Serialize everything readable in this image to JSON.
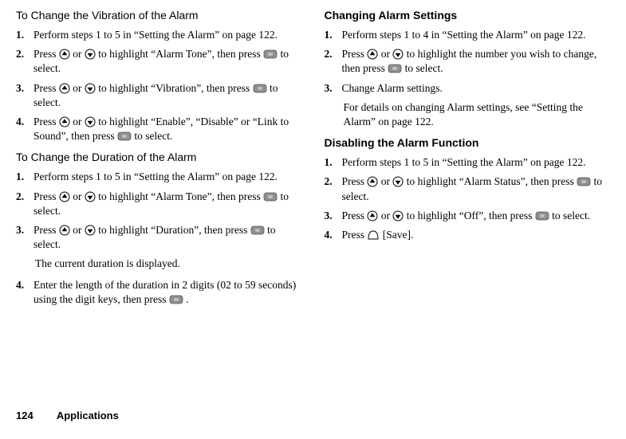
{
  "left": {
    "sectionA": {
      "title": "To Change the Vibration of the Alarm",
      "steps": [
        {
          "num": "1.",
          "text": "Perform steps 1 to 5 in “Setting the Alarm” on page 122."
        },
        {
          "num": "2.",
          "segments": [
            {
              "t": "text",
              "v": "Press "
            },
            {
              "t": "icon",
              "v": "up"
            },
            {
              "t": "text",
              "v": " or "
            },
            {
              "t": "icon",
              "v": "down"
            },
            {
              "t": "text",
              "v": " to highlight “Alarm Tone”, then press "
            },
            {
              "t": "icon",
              "v": "center"
            },
            {
              "t": "text",
              "v": " to select."
            }
          ]
        },
        {
          "num": "3.",
          "segments": [
            {
              "t": "text",
              "v": "Press "
            },
            {
              "t": "icon",
              "v": "up"
            },
            {
              "t": "text",
              "v": " or "
            },
            {
              "t": "icon",
              "v": "down"
            },
            {
              "t": "text",
              "v": " to highlight “Vibration”, then press "
            },
            {
              "t": "icon",
              "v": "center"
            },
            {
              "t": "text",
              "v": " to select."
            }
          ]
        },
        {
          "num": "4.",
          "segments": [
            {
              "t": "text",
              "v": "Press "
            },
            {
              "t": "icon",
              "v": "up"
            },
            {
              "t": "text",
              "v": " or "
            },
            {
              "t": "icon",
              "v": "down"
            },
            {
              "t": "text",
              "v": " to highlight “Enable”, “Disable” or “Link to Sound”, then press "
            },
            {
              "t": "icon",
              "v": "center"
            },
            {
              "t": "text",
              "v": " to select."
            }
          ]
        }
      ]
    },
    "sectionB": {
      "title": "To Change the Duration of the Alarm",
      "steps": [
        {
          "num": "1.",
          "text": "Perform steps 1 to 5 in “Setting the Alarm” on page 122."
        },
        {
          "num": "2.",
          "segments": [
            {
              "t": "text",
              "v": "Press "
            },
            {
              "t": "icon",
              "v": "up"
            },
            {
              "t": "text",
              "v": " or "
            },
            {
              "t": "icon",
              "v": "down"
            },
            {
              "t": "text",
              "v": " to highlight “Alarm Tone”, then press "
            },
            {
              "t": "icon",
              "v": "center"
            },
            {
              "t": "text",
              "v": " to select."
            }
          ]
        },
        {
          "num": "3.",
          "segments": [
            {
              "t": "text",
              "v": "Press "
            },
            {
              "t": "icon",
              "v": "up"
            },
            {
              "t": "text",
              "v": " or "
            },
            {
              "t": "icon",
              "v": "down"
            },
            {
              "t": "text",
              "v": " to highlight “Duration”, then press "
            },
            {
              "t": "icon",
              "v": "center"
            },
            {
              "t": "text",
              "v": " to select."
            }
          ],
          "note": "The current duration is displayed."
        },
        {
          "num": "4.",
          "segments": [
            {
              "t": "text",
              "v": "Enter the length of the duration in 2 digits (02 to 59 seconds) using the digit keys, then press "
            },
            {
              "t": "icon",
              "v": "center"
            },
            {
              "t": "text",
              "v": " ."
            }
          ]
        }
      ]
    }
  },
  "right": {
    "sectionC": {
      "title": "Changing Alarm Settings",
      "steps": [
        {
          "num": "1.",
          "text": "Perform steps 1 to 4 in “Setting the Alarm” on page 122."
        },
        {
          "num": "2.",
          "segments": [
            {
              "t": "text",
              "v": "Press "
            },
            {
              "t": "icon",
              "v": "up"
            },
            {
              "t": "text",
              "v": " or "
            },
            {
              "t": "icon",
              "v": "down"
            },
            {
              "t": "text",
              "v": " to highlight the number you wish to change, then press "
            },
            {
              "t": "icon",
              "v": "center"
            },
            {
              "t": "text",
              "v": " to select."
            }
          ]
        },
        {
          "num": "3.",
          "text": "Change Alarm settings.",
          "note": "For details on changing Alarm settings, see “Setting the Alarm” on page 122."
        }
      ]
    },
    "sectionD": {
      "title": "Disabling the Alarm Function",
      "steps": [
        {
          "num": "1.",
          "text": "Perform steps 1 to 5 in “Setting the Alarm” on page 122."
        },
        {
          "num": "2.",
          "segments": [
            {
              "t": "text",
              "v": "Press "
            },
            {
              "t": "icon",
              "v": "up"
            },
            {
              "t": "text",
              "v": " or "
            },
            {
              "t": "icon",
              "v": "down"
            },
            {
              "t": "text",
              "v": " to highlight “Alarm Status”, then press "
            },
            {
              "t": "icon",
              "v": "center"
            },
            {
              "t": "text",
              "v": " to select."
            }
          ]
        },
        {
          "num": "3.",
          "segments": [
            {
              "t": "text",
              "v": "Press "
            },
            {
              "t": "icon",
              "v": "up"
            },
            {
              "t": "text",
              "v": " or "
            },
            {
              "t": "icon",
              "v": "down"
            },
            {
              "t": "text",
              "v": " to highlight “Off”, then press "
            },
            {
              "t": "icon",
              "v": "center"
            },
            {
              "t": "text",
              "v": " to select."
            }
          ]
        },
        {
          "num": "4.",
          "segments": [
            {
              "t": "text",
              "v": "Press "
            },
            {
              "t": "icon",
              "v": "softkey"
            },
            {
              "t": "text",
              "v": " [Save]."
            }
          ]
        }
      ]
    }
  },
  "footer": {
    "page": "124",
    "section": "Applications"
  }
}
